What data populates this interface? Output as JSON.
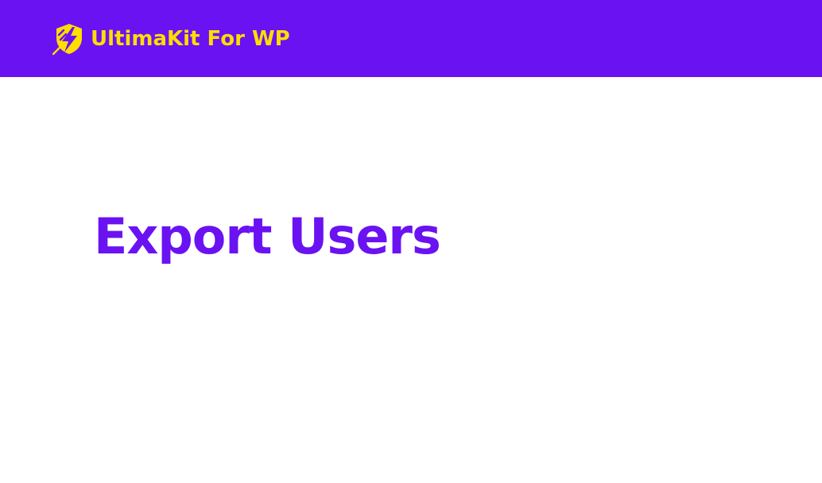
{
  "header": {
    "brand_name": "UltimaKit For WP",
    "logo_icon": "shield-lightning-icon"
  },
  "main": {
    "title": "Export Users"
  },
  "colors": {
    "header_bg": "#6a12f2",
    "brand_yellow": "#ffde00",
    "title_purple": "#6a12f2",
    "page_bg": "#ffffff"
  }
}
